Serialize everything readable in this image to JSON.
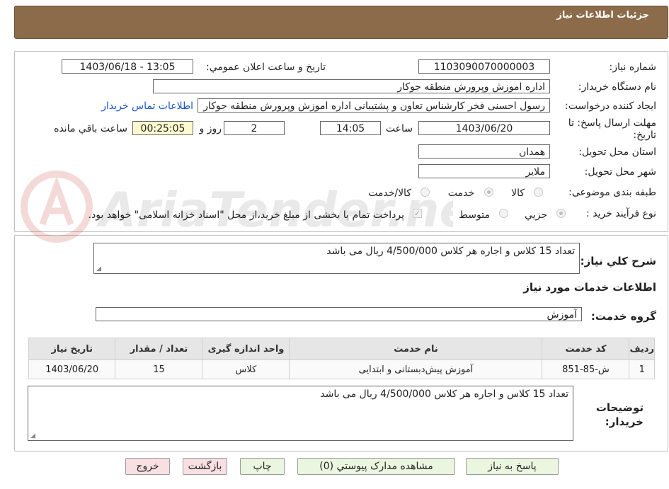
{
  "header": {
    "title": "جزئیات اطلاعات نیاز"
  },
  "fields": {
    "need_number_label": "شماره نياز:",
    "need_number": "1103090070000003",
    "announce_label": "تاريخ و ساعت اعلان عمومي:",
    "announce_value": "1403/06/18 - 13:05",
    "buyer_org_label": "نام دستگاه خريدار:",
    "buyer_org": "اداره اموزش وپرورش منطقه جوکار",
    "requester_label": "ايجاد كننده درخواست:",
    "requester": "رسول احسنی فخر کارشناس تعاون و پشتیبانی اداره اموزش وپرورش منطقه جوکار",
    "contact_link": "اطلاعات تماس خريدار",
    "deadline_label": "مهلت ارسال پاسخ: تا تاريخ:",
    "deadline_date": "1403/06/20",
    "time_label": "ساعت",
    "deadline_time": "14:05",
    "days_value": "2",
    "days_label": "روز و",
    "remaining_time": "00:25:05",
    "remaining_label": "ساعت باقي مانده",
    "province_label": "استان محل تحويل:",
    "province": "همدان",
    "city_label": "شهر محل تحويل:",
    "city": "ملاير",
    "category_label": "طبقه بندی موضوعی:",
    "category_options": [
      "كالا",
      "خدمت",
      "كالا/خدمت"
    ],
    "category_selected": "خدمت",
    "process_label": "نوع فرآيند خريد :",
    "process_options": [
      "جزيي",
      "متوسط"
    ],
    "process_selected": "جزيي",
    "treasury_note": "پرداخت تمام يا بخشی از مبلغ خريد،از محل \"اسناد خزانه اسلامی\" خواهد بود."
  },
  "description": {
    "label": "شرح كلي نياز:",
    "text": "تعداد 15 کلاس و اجاره  هر کلاس  4/500/000  ریال می باشد"
  },
  "services": {
    "section_title": "اطلاعات خدمات مورد نياز",
    "group_label": "گروه خدمت:",
    "group_value": "آموزش",
    "columns": [
      "رديف",
      "كد خدمت",
      "نام خدمت",
      "واحد اندازه گيری",
      "تعداد / مقدار",
      "تاريخ نياز"
    ],
    "rows": [
      [
        "1",
        "ش-85-851",
        "آموزش پیش‌دبستانی و ابتدایی",
        "کلاس",
        "15",
        "1403/06/20"
      ]
    ]
  },
  "buyer_notes": {
    "label": "توضيحات خريدار:",
    "text": "تعداد 15 کلاس و اجاره  هر کلاس  4/500/000  ریال می باشد"
  },
  "buttons": {
    "reply": "پاسخ به نياز",
    "attachments": "مشاهده مدارک پيوستي (0)",
    "print": "چاپ",
    "back": "بازگشت",
    "exit": "خروج"
  },
  "watermark": {
    "text": "AriaTender.neT"
  },
  "colors": {
    "header_bg": "#8b6b4a",
    "link": "#1a56c2",
    "btn_green": "#eaf6df",
    "btn_red": "#f7dfe2",
    "timer_bg": "#fffbd0"
  }
}
